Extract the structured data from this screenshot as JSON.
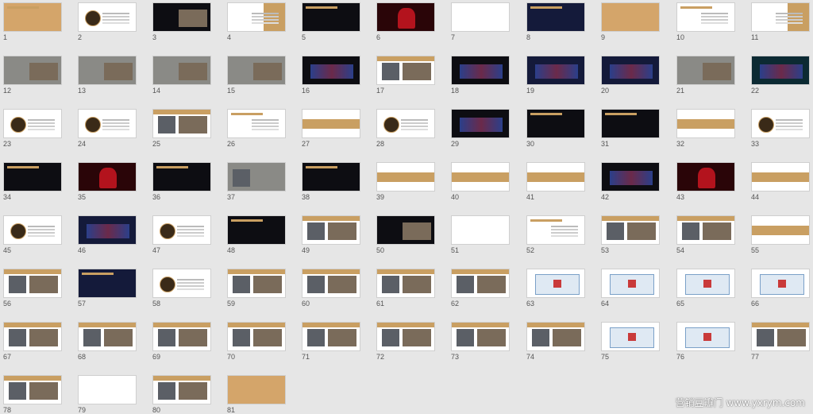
{
  "view": "slide-sorter",
  "slides": [
    {
      "n": "1",
      "style": "gold-title"
    },
    {
      "n": "2",
      "style": "white-circle"
    },
    {
      "n": "3",
      "style": "dark-photo"
    },
    {
      "n": "4",
      "style": "white-gold-side"
    },
    {
      "n": "5",
      "style": "dark"
    },
    {
      "n": "6",
      "style": "red-dress"
    },
    {
      "n": "7",
      "style": "white"
    },
    {
      "n": "8",
      "style": "navy"
    },
    {
      "n": "9",
      "style": "gold"
    },
    {
      "n": "10",
      "style": "white-title"
    },
    {
      "n": "11",
      "style": "white-gold-side"
    },
    {
      "n": "12",
      "style": "photo"
    },
    {
      "n": "13",
      "style": "photo"
    },
    {
      "n": "14",
      "style": "photo"
    },
    {
      "n": "15",
      "style": "photo"
    },
    {
      "n": "16",
      "style": "dark-stage"
    },
    {
      "n": "17",
      "style": "white-photo"
    },
    {
      "n": "18",
      "style": "dark-stage"
    },
    {
      "n": "19",
      "style": "navy-stage"
    },
    {
      "n": "20",
      "style": "navy-stage"
    },
    {
      "n": "21",
      "style": "photo"
    },
    {
      "n": "22",
      "style": "teal"
    },
    {
      "n": "23",
      "style": "white-circle"
    },
    {
      "n": "24",
      "style": "white-circle"
    },
    {
      "n": "25",
      "style": "white-photo"
    },
    {
      "n": "26",
      "style": "white-title"
    },
    {
      "n": "27",
      "style": "white-gold-band"
    },
    {
      "n": "28",
      "style": "white-circle"
    },
    {
      "n": "29",
      "style": "dark-stage"
    },
    {
      "n": "30",
      "style": "dark"
    },
    {
      "n": "31",
      "style": "dark"
    },
    {
      "n": "32",
      "style": "white-gold-band"
    },
    {
      "n": "33",
      "style": "white-circle"
    },
    {
      "n": "34",
      "style": "dark"
    },
    {
      "n": "35",
      "style": "red-dress"
    },
    {
      "n": "36",
      "style": "dark"
    },
    {
      "n": "37",
      "style": "gray"
    },
    {
      "n": "38",
      "style": "dark"
    },
    {
      "n": "39",
      "style": "white-gold-band"
    },
    {
      "n": "40",
      "style": "white-gold-band"
    },
    {
      "n": "41",
      "style": "white-gold-band"
    },
    {
      "n": "42",
      "style": "dark-stage"
    },
    {
      "n": "43",
      "style": "red-dress"
    },
    {
      "n": "44",
      "style": "white-gold-band"
    },
    {
      "n": "45",
      "style": "white-circle"
    },
    {
      "n": "46",
      "style": "navy-stage"
    },
    {
      "n": "47",
      "style": "white-circle"
    },
    {
      "n": "48",
      "style": "dark"
    },
    {
      "n": "49",
      "style": "white-photo"
    },
    {
      "n": "50",
      "style": "dark-photo"
    },
    {
      "n": "51",
      "style": "white"
    },
    {
      "n": "52",
      "style": "white-title"
    },
    {
      "n": "53",
      "style": "white-photo"
    },
    {
      "n": "54",
      "style": "white-photo"
    },
    {
      "n": "55",
      "style": "white-gold-band"
    },
    {
      "n": "56",
      "style": "white-photo"
    },
    {
      "n": "57",
      "style": "navy"
    },
    {
      "n": "58",
      "style": "white-circle"
    },
    {
      "n": "59",
      "style": "white-photo"
    },
    {
      "n": "60",
      "style": "white-photo"
    },
    {
      "n": "61",
      "style": "white-photo"
    },
    {
      "n": "62",
      "style": "white-photo"
    },
    {
      "n": "63",
      "style": "white-map"
    },
    {
      "n": "64",
      "style": "white-map"
    },
    {
      "n": "65",
      "style": "white-map"
    },
    {
      "n": "66",
      "style": "white-map"
    },
    {
      "n": "67",
      "style": "white-photo"
    },
    {
      "n": "68",
      "style": "white-photo"
    },
    {
      "n": "69",
      "style": "white-photo"
    },
    {
      "n": "70",
      "style": "white-photo"
    },
    {
      "n": "71",
      "style": "white-photo"
    },
    {
      "n": "72",
      "style": "white-photo"
    },
    {
      "n": "73",
      "style": "white-photo"
    },
    {
      "n": "74",
      "style": "white-photo"
    },
    {
      "n": "75",
      "style": "white-map"
    },
    {
      "n": "76",
      "style": "white-map"
    },
    {
      "n": "77",
      "style": "white-photo"
    },
    {
      "n": "78",
      "style": "white-photo"
    },
    {
      "n": "79",
      "style": "white"
    },
    {
      "n": "80",
      "style": "white-photo"
    },
    {
      "n": "81",
      "style": "gold"
    }
  ],
  "watermark": "营销豆瓣门 www.yxrym.com"
}
